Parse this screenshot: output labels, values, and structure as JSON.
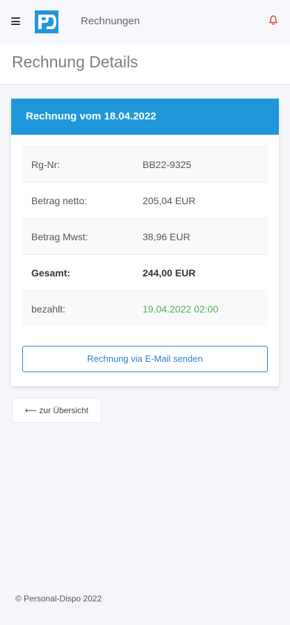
{
  "app": {
    "title": "Rechnungen",
    "logo_text": "PD",
    "menu_icon": "hamburger-menu-icon",
    "notification_icon": "bell-icon",
    "brand_color": "#1f97da",
    "alert_color": "#e53935"
  },
  "page": {
    "title": "Rechnung Details"
  },
  "invoice": {
    "header": "Rechnung vom 18.04.2022",
    "rows": [
      {
        "label": "Rg-Nr:",
        "value": "BB22-9325"
      },
      {
        "label": "Betrag netto:",
        "value": "205,04 EUR"
      },
      {
        "label": "Betrag Mwst:",
        "value": "38,96 EUR"
      },
      {
        "label": "Gesamt:",
        "value": "244,00 EUR"
      },
      {
        "label": "bezahlt:",
        "value": "19.04.2022 02:00"
      }
    ],
    "email_button": "Rechnung via E-Mail senden"
  },
  "back_button": "⟵ zur Übersicht",
  "footer": "© Personal-Dispo 2022"
}
